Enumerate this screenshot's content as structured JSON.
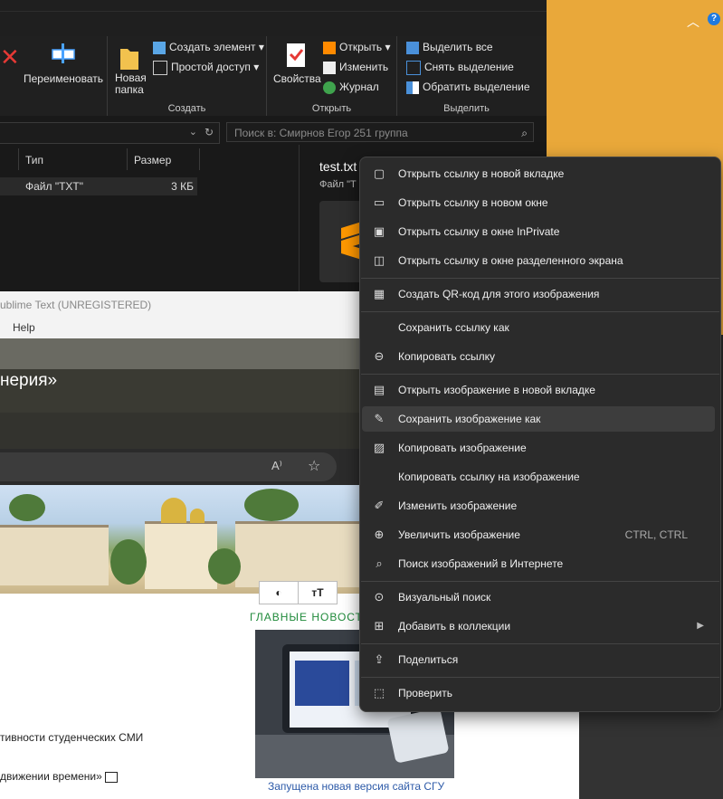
{
  "explorer": {
    "ribbon": {
      "rename": "Переименовать",
      "new_folder": "Новая\nпапка",
      "create_item": "Создать элемент",
      "easy_access": "Простой доступ",
      "properties": "Свойства",
      "open": "Открыть",
      "edit": "Изменить",
      "journal": "Журнал",
      "select_all": "Выделить все",
      "deselect": "Снять выделение",
      "invert": "Обратить выделение",
      "group_create": "Создать",
      "group_open": "Открыть",
      "group_select": "Выделить"
    },
    "search_placeholder": "Поиск в: Смирнов Егор 251 группа",
    "columns": [
      "Тип",
      "Размер"
    ],
    "row": {
      "type": "Файл \"TXT\"",
      "size": "3 КБ"
    },
    "preview_filename": "test.txt",
    "preview_type": "Файл \"T"
  },
  "sublime": {
    "title": "ublime Text (UNREGISTERED)",
    "menu_help": "Help"
  },
  "page": {
    "heading": "нерия»",
    "news_title": "ГЛАВНЫЕ НОВОСТИ",
    "news_caption": "Запущена новая версия сайта СГУ",
    "text1": "тивности студенческих СМИ",
    "text2": "движении времени»"
  },
  "context_menu": {
    "items": [
      {
        "label": "Открыть ссылку в новой вкладке",
        "icon": "new-tab-icon"
      },
      {
        "label": "Открыть ссылку в новом окне",
        "icon": "new-window-icon"
      },
      {
        "label": "Открыть ссылку в окне InPrivate",
        "icon": "inprivate-icon"
      },
      {
        "label": "Открыть ссылку в окне разделенного экрана",
        "icon": "split-screen-icon"
      },
      {
        "label": "Создать QR-код для этого изображения",
        "icon": "qr-code-icon"
      },
      {
        "label": "Сохранить ссылку как",
        "icon": ""
      },
      {
        "label": "Копировать ссылку",
        "icon": "link-icon"
      },
      {
        "label": "Открыть изображение в новой вкладке",
        "icon": "image-tab-icon"
      },
      {
        "label": "Сохранить изображение как",
        "icon": "save-image-icon",
        "highlighted": true
      },
      {
        "label": "Копировать изображение",
        "icon": "copy-image-icon"
      },
      {
        "label": "Копировать ссылку на изображение",
        "icon": ""
      },
      {
        "label": "Изменить изображение",
        "icon": "edit-image-icon"
      },
      {
        "label": "Увеличить изображение",
        "icon": "zoom-icon",
        "shortcut": "CTRL, CTRL"
      },
      {
        "label": "Поиск изображений в Интернете",
        "icon": "image-search-icon"
      },
      {
        "label": "Визуальный поиск",
        "icon": "visual-search-icon"
      },
      {
        "label": "Добавить в коллекции",
        "icon": "collections-icon",
        "submenu": true
      },
      {
        "label": "Поделиться",
        "icon": "share-icon"
      },
      {
        "label": "Проверить",
        "icon": "inspect-icon"
      }
    ]
  }
}
